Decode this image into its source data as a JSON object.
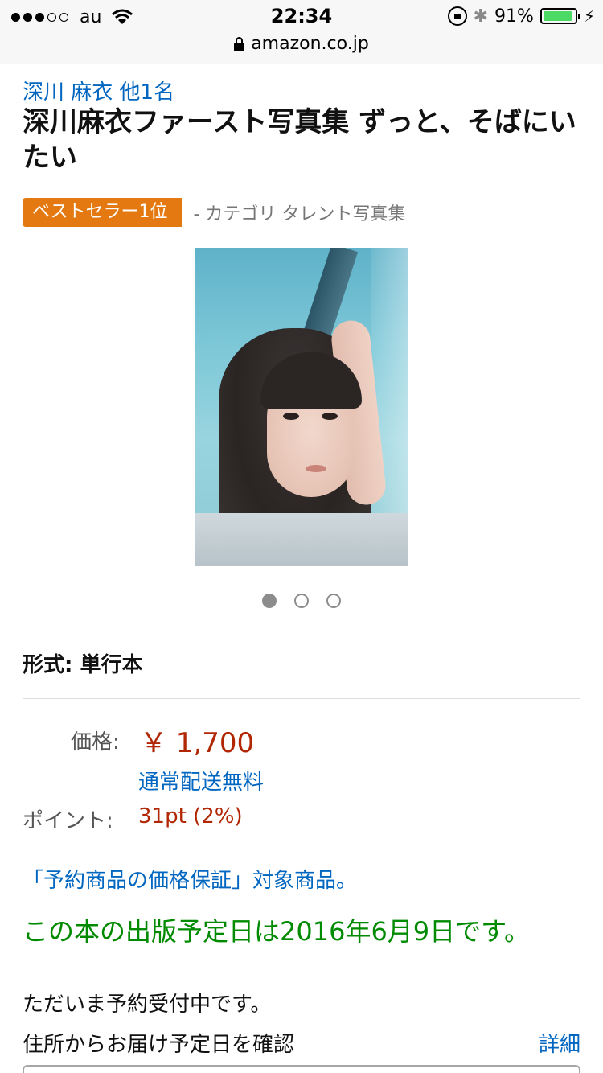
{
  "status_bar": {
    "carrier": "au",
    "time": "22:34",
    "battery_percent": "91%",
    "battery_level": 0.91,
    "signal_bars_filled": 3,
    "signal_bars_total": 5
  },
  "browser": {
    "url": "amazon.co.jp"
  },
  "product": {
    "author": "深川 麻衣 他1名",
    "title": "深川麻衣ファースト写真集 ずっと、そばにいたい",
    "bestseller_badge": "ベストセラー1位",
    "category": "- カテゴリ タレント写真集",
    "image_pager": {
      "total": 3,
      "active_index": 0
    },
    "format": "形式: 単行本",
    "price_label": "価格:",
    "price_value": "￥ 1,700",
    "shipping": "通常配送無料",
    "points_label": "ポイント:",
    "points_value": "31pt  (2%)",
    "guarantee_link": "「予約商品の価格保証」対象商品。",
    "release_notice": "この本の出版予定日は2016年6月9日です。",
    "preorder_notice": "ただいま予約受付中です。",
    "delivery_check": "住所からお届け予定日を確認",
    "details_link": "詳細"
  },
  "colors": {
    "link": "#0066c0",
    "price": "#b12704",
    "badge": "#e47911",
    "availability": "#008a00",
    "battery": "#4cd964"
  }
}
